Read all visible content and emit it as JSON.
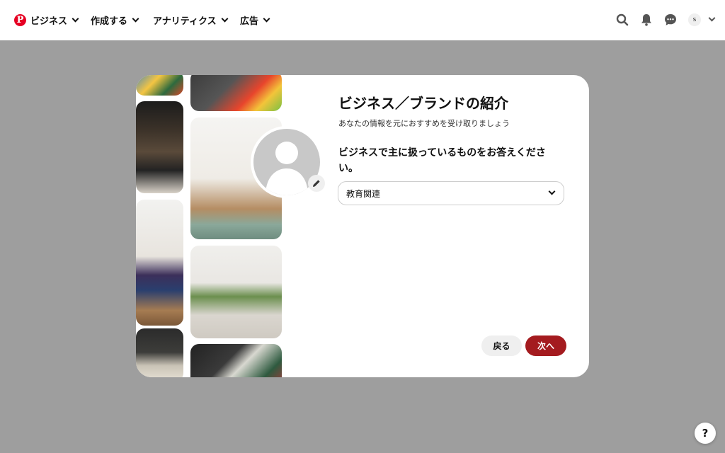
{
  "nav": {
    "brand_label": "ビジネス",
    "create_label": "作成する",
    "analytics_label": "アナリティクス",
    "ads_label": "広告"
  },
  "account": {
    "avatar_initial": "s"
  },
  "modal": {
    "title": "ビジネス／ブランドの紹介",
    "subtitle": "あなたの情報を元におすすめを受け取りましょう",
    "question": "ビジネスで主に扱っているものをお答えください。",
    "select_value": "教育関連",
    "back_label": "戻る",
    "next_label": "次へ"
  },
  "help_label": "?",
  "colors": {
    "brand": "#e60023",
    "next_button": "#a41b1f",
    "overlay": "#9e9e9e"
  }
}
